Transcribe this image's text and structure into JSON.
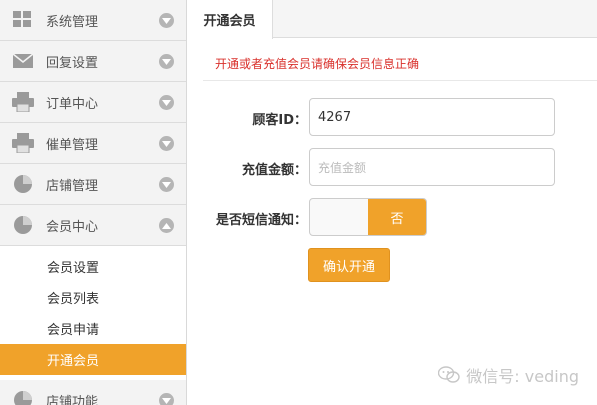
{
  "sidebar": {
    "items": [
      {
        "label": "系统管理",
        "icon": "grid-icon"
      },
      {
        "label": "回复设置",
        "icon": "mail-icon"
      },
      {
        "label": "订单中心",
        "icon": "printer-icon"
      },
      {
        "label": "催单管理",
        "icon": "printer-icon"
      },
      {
        "label": "店铺管理",
        "icon": "pie-chart-icon"
      },
      {
        "label": "会员中心",
        "icon": "pie-chart-icon"
      }
    ],
    "sub_items": [
      "会员设置",
      "会员列表",
      "会员申请",
      "开通会员"
    ],
    "next_item": {
      "label": "店铺功能",
      "icon": "pie-chart-icon"
    }
  },
  "tab": {
    "label": "开通会员"
  },
  "notice": "开通或者充值会员请确保会员信息正确",
  "form": {
    "customer_id_label": "顾客ID：",
    "customer_id_value": "4267",
    "amount_label": "充值金额：",
    "amount_placeholder": "充值金额",
    "sms_label": "是否短信通知：",
    "sms_toggle_off": "否",
    "confirm_label": "确认开通"
  },
  "watermark": "微信号: veding",
  "colors": {
    "accent": "#f0a22a",
    "notice": "#d9302b"
  }
}
